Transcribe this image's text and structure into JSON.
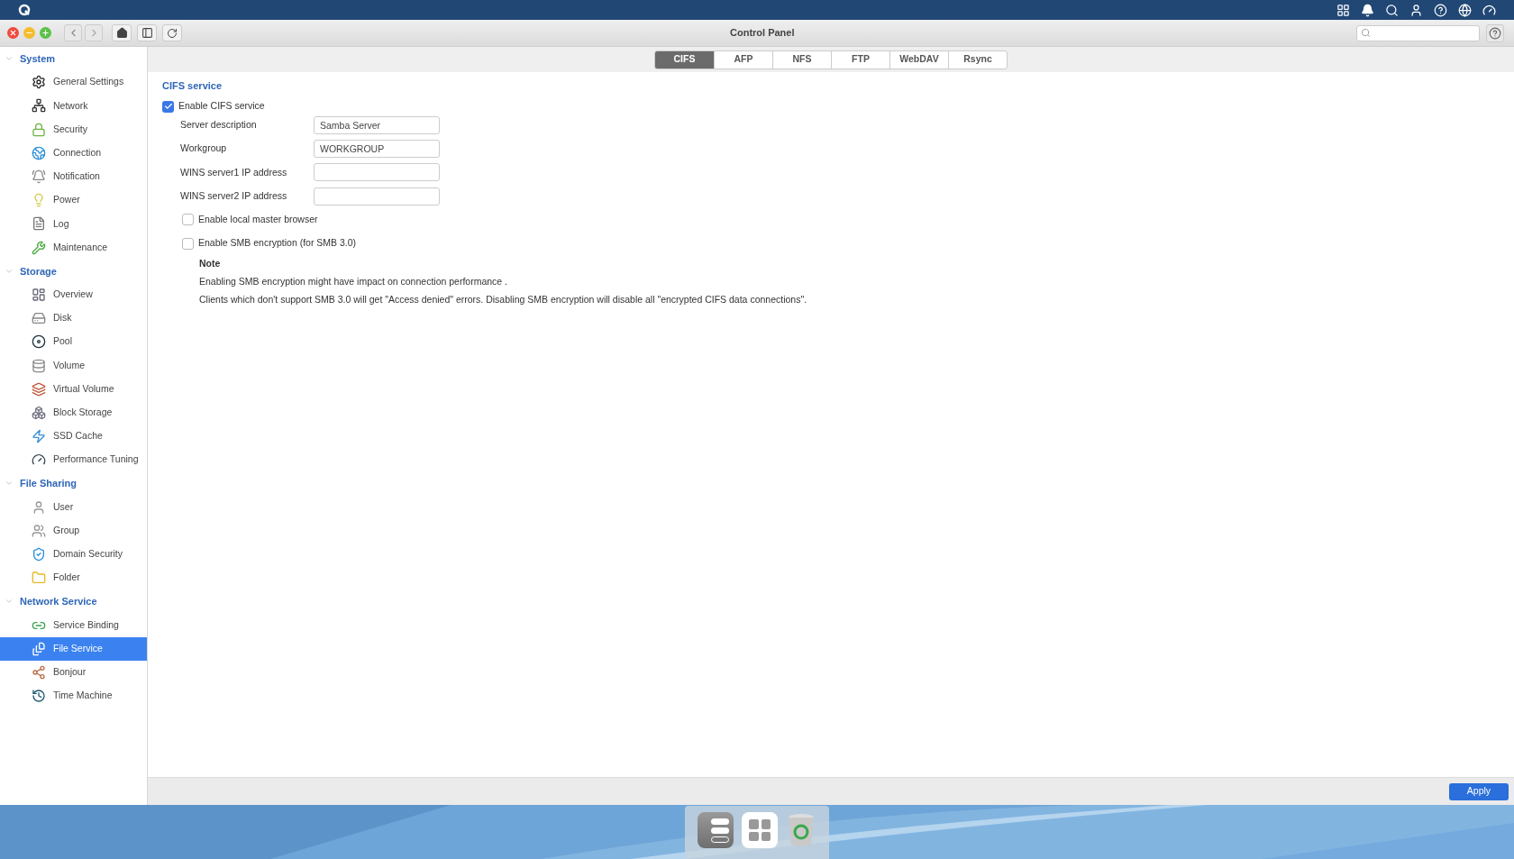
{
  "window": {
    "title": "Control Panel"
  },
  "sidebar": {
    "groups": [
      {
        "label": "System",
        "expanded": true,
        "items": [
          {
            "label": "General Settings",
            "selected": false
          },
          {
            "label": "Network",
            "selected": false
          },
          {
            "label": "Security",
            "selected": false
          },
          {
            "label": "Connection",
            "selected": false
          },
          {
            "label": "Notification",
            "selected": false
          },
          {
            "label": "Power",
            "selected": false
          },
          {
            "label": "Log",
            "selected": false
          },
          {
            "label": "Maintenance",
            "selected": false
          }
        ]
      },
      {
        "label": "Storage",
        "expanded": true,
        "items": [
          {
            "label": "Overview",
            "selected": false
          },
          {
            "label": "Disk",
            "selected": false
          },
          {
            "label": "Pool",
            "selected": false
          },
          {
            "label": "Volume",
            "selected": false
          },
          {
            "label": "Virtual Volume",
            "selected": false
          },
          {
            "label": "Block Storage",
            "selected": false
          },
          {
            "label": "SSD Cache",
            "selected": false
          },
          {
            "label": "Performance Tuning",
            "selected": false
          }
        ]
      },
      {
        "label": "File Sharing",
        "expanded": true,
        "items": [
          {
            "label": "User",
            "selected": false
          },
          {
            "label": "Group",
            "selected": false
          },
          {
            "label": "Domain Security",
            "selected": false
          },
          {
            "label": "Folder",
            "selected": false
          }
        ]
      },
      {
        "label": "Network Service",
        "expanded": true,
        "items": [
          {
            "label": "Service Binding",
            "selected": false
          },
          {
            "label": "File Service",
            "selected": true
          },
          {
            "label": "Bonjour",
            "selected": false
          },
          {
            "label": "Time Machine",
            "selected": false
          }
        ]
      }
    ]
  },
  "tabs": [
    {
      "label": "CIFS",
      "selected": true
    },
    {
      "label": "AFP",
      "selected": false
    },
    {
      "label": "NFS",
      "selected": false
    },
    {
      "label": "FTP",
      "selected": false
    },
    {
      "label": "WebDAV",
      "selected": false
    },
    {
      "label": "Rsync",
      "selected": false
    }
  ],
  "section_title": "CIFS service",
  "enable": {
    "label": "Enable CIFS service",
    "checked": true
  },
  "fields": [
    {
      "label": "Server description",
      "value": "Samba Server"
    },
    {
      "label": "Workgroup",
      "value": "WORKGROUP"
    },
    {
      "label": "WINS server1 IP address"
    },
    {
      "label": "WINS server2 IP address"
    }
  ],
  "options": [
    {
      "label": "Enable local master browser",
      "checked": false
    },
    {
      "label": "Enable SMB encryption (for SMB 3.0)",
      "checked": false
    }
  ],
  "note": {
    "title": "Note",
    "lines": [
      "Enabling SMB encryption might have impact on connection performance .",
      "Clients which don't support SMB 3.0 will get \"Access denied\" errors. Disabling SMB encryption will disable all \"encrypted CIFS data connections\"."
    ]
  },
  "apply_button": "Apply"
}
